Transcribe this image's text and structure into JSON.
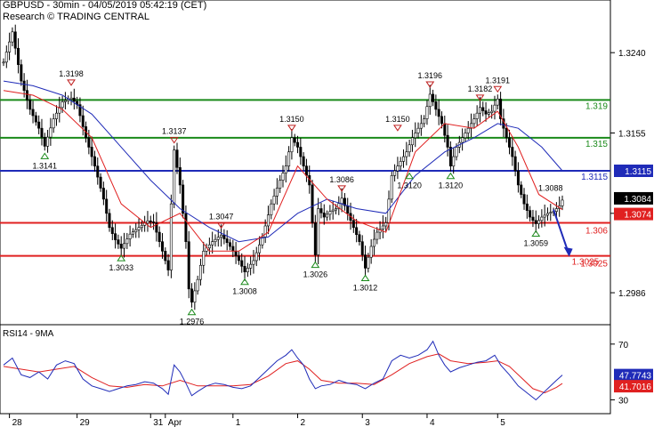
{
  "header": {
    "title": "GBPUSD - 30min - 04/05/2019 05:42:19 (CET)",
    "credit": "Research © TRADING CENTRAL"
  },
  "colors": {
    "candle": "#000000",
    "ma_fast": "#e02020",
    "ma_slow": "#1f2bb8",
    "resistance": "#1a8a1a",
    "pivot": "#1f2bb8",
    "support": "#e02020",
    "arrow": "#1f2bb8",
    "rsi": "#1f2bb8",
    "rsi_ma": "#e02020"
  },
  "chart_data": [
    {
      "type": "candlestick",
      "name": "price",
      "ylim": [
        1.2955,
        1.3275
      ],
      "y_ticks": [
        "1.3240",
        "1.3155",
        "1.3070",
        "1.2986"
      ],
      "x_ticks": [
        "28",
        "29",
        "31",
        "Apr",
        "1",
        "2",
        "3",
        "4",
        "5"
      ],
      "last_price": "1.3084",
      "ma_value": "1.3074",
      "arrow_target": "1.3025",
      "close_path": [
        [
          0,
          1.323
        ],
        [
          3,
          1.3262
        ],
        [
          6,
          1.321
        ],
        [
          9,
          1.318
        ],
        [
          12,
          1.316
        ],
        [
          14,
          1.3141
        ],
        [
          17,
          1.317
        ],
        [
          20,
          1.3188
        ],
        [
          23,
          1.3192
        ],
        [
          25,
          1.3185
        ],
        [
          28,
          1.315
        ],
        [
          31,
          1.312
        ],
        [
          34,
          1.3085
        ],
        [
          36,
          1.3055
        ],
        [
          38,
          1.3042
        ],
        [
          40,
          1.3033
        ],
        [
          43,
          1.3048
        ],
        [
          46,
          1.3055
        ],
        [
          49,
          1.3062
        ],
        [
          51,
          1.306
        ],
        [
          53,
          1.304
        ],
        [
          55,
          1.302
        ],
        [
          56,
          1.301
        ],
        [
          57,
          1.308
        ],
        [
          58,
          1.3137
        ],
        [
          60,
          1.31
        ],
        [
          62,
          1.304
        ],
        [
          63,
          1.299
        ],
        [
          64,
          1.2976
        ],
        [
          66,
          1.3
        ],
        [
          68,
          1.303
        ],
        [
          71,
          1.304
        ],
        [
          74,
          1.3047
        ],
        [
          77,
          1.3035
        ],
        [
          80,
          1.302
        ],
        [
          82,
          1.3008
        ],
        [
          85,
          1.302
        ],
        [
          88,
          1.3045
        ],
        [
          91,
          1.308
        ],
        [
          94,
          1.3105
        ],
        [
          96,
          1.312
        ],
        [
          98,
          1.315
        ],
        [
          100,
          1.314
        ],
        [
          102,
          1.312
        ],
        [
          104,
          1.31
        ],
        [
          105,
          1.306
        ],
        [
          106,
          1.3026
        ],
        [
          107,
          1.3075
        ],
        [
          109,
          1.3066
        ],
        [
          111,
          1.3072
        ],
        [
          113,
          1.3075
        ],
        [
          115,
          1.3086
        ],
        [
          117,
          1.307
        ],
        [
          119,
          1.3055
        ],
        [
          121,
          1.304
        ],
        [
          123,
          1.3012
        ],
        [
          125,
          1.3035
        ],
        [
          127,
          1.305
        ],
        [
          130,
          1.306
        ],
        [
          132,
          1.311
        ],
        [
          134,
          1.312
        ],
        [
          137,
          1.3135
        ],
        [
          139,
          1.315
        ],
        [
          141,
          1.316
        ],
        [
          143,
          1.317
        ],
        [
          145,
          1.3196
        ],
        [
          147,
          1.318
        ],
        [
          149,
          1.3165
        ],
        [
          151,
          1.314
        ],
        [
          152,
          1.312
        ],
        [
          154,
          1.314
        ],
        [
          156,
          1.315
        ],
        [
          158,
          1.316
        ],
        [
          160,
          1.317
        ],
        [
          162,
          1.3182
        ],
        [
          164,
          1.3175
        ],
        [
          166,
          1.3178
        ],
        [
          168,
          1.3191
        ],
        [
          169,
          1.317
        ],
        [
          171,
          1.315
        ],
        [
          173,
          1.313
        ],
        [
          175,
          1.31
        ],
        [
          177,
          1.308
        ],
        [
          179,
          1.3066
        ],
        [
          181,
          1.3059
        ],
        [
          183,
          1.3066
        ],
        [
          185,
          1.307
        ],
        [
          187,
          1.3072
        ],
        [
          189,
          1.3078
        ],
        [
          190,
          1.3084
        ]
      ],
      "ma_fast_path": [
        [
          0,
          1.32
        ],
        [
          10,
          1.3195
        ],
        [
          20,
          1.318
        ],
        [
          30,
          1.315
        ],
        [
          40,
          1.308
        ],
        [
          50,
          1.3055
        ],
        [
          60,
          1.307
        ],
        [
          70,
          1.303
        ],
        [
          80,
          1.303
        ],
        [
          90,
          1.305
        ],
        [
          100,
          1.312
        ],
        [
          110,
          1.3085
        ],
        [
          120,
          1.3062
        ],
        [
          130,
          1.305
        ],
        [
          140,
          1.3135
        ],
        [
          150,
          1.3165
        ],
        [
          160,
          1.316
        ],
        [
          168,
          1.3178
        ],
        [
          175,
          1.314
        ],
        [
          182,
          1.309
        ],
        [
          190,
          1.3074
        ]
      ],
      "ma_slow_path": [
        [
          0,
          1.321
        ],
        [
          10,
          1.3205
        ],
        [
          20,
          1.3195
        ],
        [
          30,
          1.3175
        ],
        [
          40,
          1.314
        ],
        [
          50,
          1.3105
        ],
        [
          60,
          1.3075
        ],
        [
          70,
          1.3055
        ],
        [
          80,
          1.304
        ],
        [
          90,
          1.3045
        ],
        [
          100,
          1.307
        ],
        [
          110,
          1.3085
        ],
        [
          120,
          1.3075
        ],
        [
          130,
          1.307
        ],
        [
          140,
          1.311
        ],
        [
          150,
          1.3135
        ],
        [
          160,
          1.315
        ],
        [
          168,
          1.3165
        ],
        [
          175,
          1.316
        ],
        [
          183,
          1.314
        ],
        [
          190,
          1.3115
        ]
      ],
      "levels": [
        {
          "value": 1.319,
          "label": "1.319",
          "kind": "resistance"
        },
        {
          "value": 1.315,
          "label": "1.315",
          "kind": "resistance"
        },
        {
          "value": 1.3115,
          "label": "1.3115",
          "kind": "pivot"
        },
        {
          "value": 1.306,
          "label": "1.306",
          "kind": "support"
        },
        {
          "value": 1.3025,
          "label": "1.3025",
          "kind": "support"
        }
      ],
      "annotations": [
        {
          "x": 14,
          "value": 1.3141,
          "label": "1.3141",
          "dir": "low"
        },
        {
          "x": 23,
          "value": 1.3198,
          "label": "1.3198",
          "dir": "high"
        },
        {
          "x": 40,
          "value": 1.3033,
          "label": "1.3033",
          "dir": "low"
        },
        {
          "x": 58,
          "value": 1.3137,
          "label": "1.3137",
          "dir": "high"
        },
        {
          "x": 64,
          "value": 1.2976,
          "label": "1.2976",
          "dir": "low"
        },
        {
          "x": 74,
          "value": 1.3047,
          "label": "1.3047",
          "dir": "high"
        },
        {
          "x": 82,
          "value": 1.3008,
          "label": "1.3008",
          "dir": "low"
        },
        {
          "x": 98,
          "value": 1.315,
          "label": "1.3150",
          "dir": "high"
        },
        {
          "x": 106,
          "value": 1.3026,
          "label": "1.3026",
          "dir": "low"
        },
        {
          "x": 115,
          "value": 1.3086,
          "label": "1.3086",
          "dir": "high"
        },
        {
          "x": 123,
          "value": 1.3012,
          "label": "1.3012",
          "dir": "low"
        },
        {
          "x": 134,
          "value": 1.315,
          "label": "1.3150",
          "dir": "high"
        },
        {
          "x": 138,
          "value": 1.312,
          "label": "1.3120",
          "dir": "low"
        },
        {
          "x": 145,
          "value": 1.3196,
          "label": "1.3196",
          "dir": "high"
        },
        {
          "x": 152,
          "value": 1.312,
          "label": "1.3120",
          "dir": "low"
        },
        {
          "x": 162,
          "value": 1.3182,
          "label": "1.3182",
          "dir": "high"
        },
        {
          "x": 168,
          "value": 1.3191,
          "label": "1.3191",
          "dir": "high"
        },
        {
          "x": 181,
          "value": 1.3059,
          "label": "1.3059",
          "dir": "low"
        }
      ],
      "extra_labels": [
        {
          "x": 186,
          "value": 1.3088,
          "label": "1.3088"
        }
      ]
    },
    {
      "type": "line",
      "name": "rsi",
      "title": "RSI14 - 9MA",
      "ylim": [
        22,
        82
      ],
      "y_ticks": [
        "70",
        "30"
      ],
      "rsi_value": "47.7743",
      "rsi_ma_value": "41.7016",
      "rsi_path": [
        [
          0,
          55
        ],
        [
          3,
          60
        ],
        [
          6,
          48
        ],
        [
          9,
          46
        ],
        [
          12,
          50
        ],
        [
          15,
          45
        ],
        [
          18,
          55
        ],
        [
          21,
          58
        ],
        [
          24,
          56
        ],
        [
          27,
          45
        ],
        [
          30,
          40
        ],
        [
          33,
          38
        ],
        [
          36,
          36
        ],
        [
          39,
          38
        ],
        [
          42,
          40
        ],
        [
          45,
          41
        ],
        [
          48,
          43
        ],
        [
          51,
          42
        ],
        [
          54,
          38
        ],
        [
          56,
          34
        ],
        [
          58,
          55
        ],
        [
          60,
          50
        ],
        [
          62,
          42
        ],
        [
          64,
          33
        ],
        [
          66,
          36
        ],
        [
          69,
          40
        ],
        [
          72,
          42
        ],
        [
          75,
          41
        ],
        [
          78,
          39
        ],
        [
          81,
          38
        ],
        [
          84,
          40
        ],
        [
          87,
          46
        ],
        [
          90,
          52
        ],
        [
          93,
          58
        ],
        [
          96,
          62
        ],
        [
          98,
          66
        ],
        [
          100,
          60
        ],
        [
          102,
          55
        ],
        [
          104,
          45
        ],
        [
          106,
          38
        ],
        [
          108,
          40
        ],
        [
          111,
          41
        ],
        [
          114,
          44
        ],
        [
          117,
          42
        ],
        [
          120,
          41
        ],
        [
          123,
          38
        ],
        [
          126,
          42
        ],
        [
          129,
          45
        ],
        [
          132,
          58
        ],
        [
          135,
          62
        ],
        [
          138,
          60
        ],
        [
          141,
          62
        ],
        [
          144,
          66
        ],
        [
          146,
          72
        ],
        [
          148,
          62
        ],
        [
          150,
          55
        ],
        [
          152,
          50
        ],
        [
          155,
          53
        ],
        [
          158,
          55
        ],
        [
          161,
          57
        ],
        [
          164,
          58
        ],
        [
          167,
          62
        ],
        [
          169,
          55
        ],
        [
          172,
          48
        ],
        [
          175,
          40
        ],
        [
          178,
          35
        ],
        [
          181,
          30
        ],
        [
          183,
          34
        ],
        [
          186,
          40
        ],
        [
          188,
          44
        ],
        [
          190,
          47.8
        ]
      ],
      "rsi_ma_path": [
        [
          0,
          54
        ],
        [
          6,
          52
        ],
        [
          12,
          50
        ],
        [
          18,
          52
        ],
        [
          24,
          54
        ],
        [
          30,
          46
        ],
        [
          36,
          40
        ],
        [
          42,
          39
        ],
        [
          48,
          41
        ],
        [
          54,
          40
        ],
        [
          60,
          44
        ],
        [
          66,
          40
        ],
        [
          72,
          40
        ],
        [
          78,
          40
        ],
        [
          84,
          41
        ],
        [
          90,
          47
        ],
        [
          96,
          56
        ],
        [
          100,
          58
        ],
        [
          104,
          52
        ],
        [
          108,
          44
        ],
        [
          114,
          42
        ],
        [
          120,
          42
        ],
        [
          126,
          41
        ],
        [
          132,
          48
        ],
        [
          138,
          56
        ],
        [
          144,
          61
        ],
        [
          148,
          63
        ],
        [
          152,
          58
        ],
        [
          158,
          56
        ],
        [
          164,
          57
        ],
        [
          168,
          58
        ],
        [
          172,
          54
        ],
        [
          176,
          46
        ],
        [
          180,
          38
        ],
        [
          184,
          35
        ],
        [
          188,
          39
        ],
        [
          190,
          41.7
        ]
      ]
    }
  ]
}
